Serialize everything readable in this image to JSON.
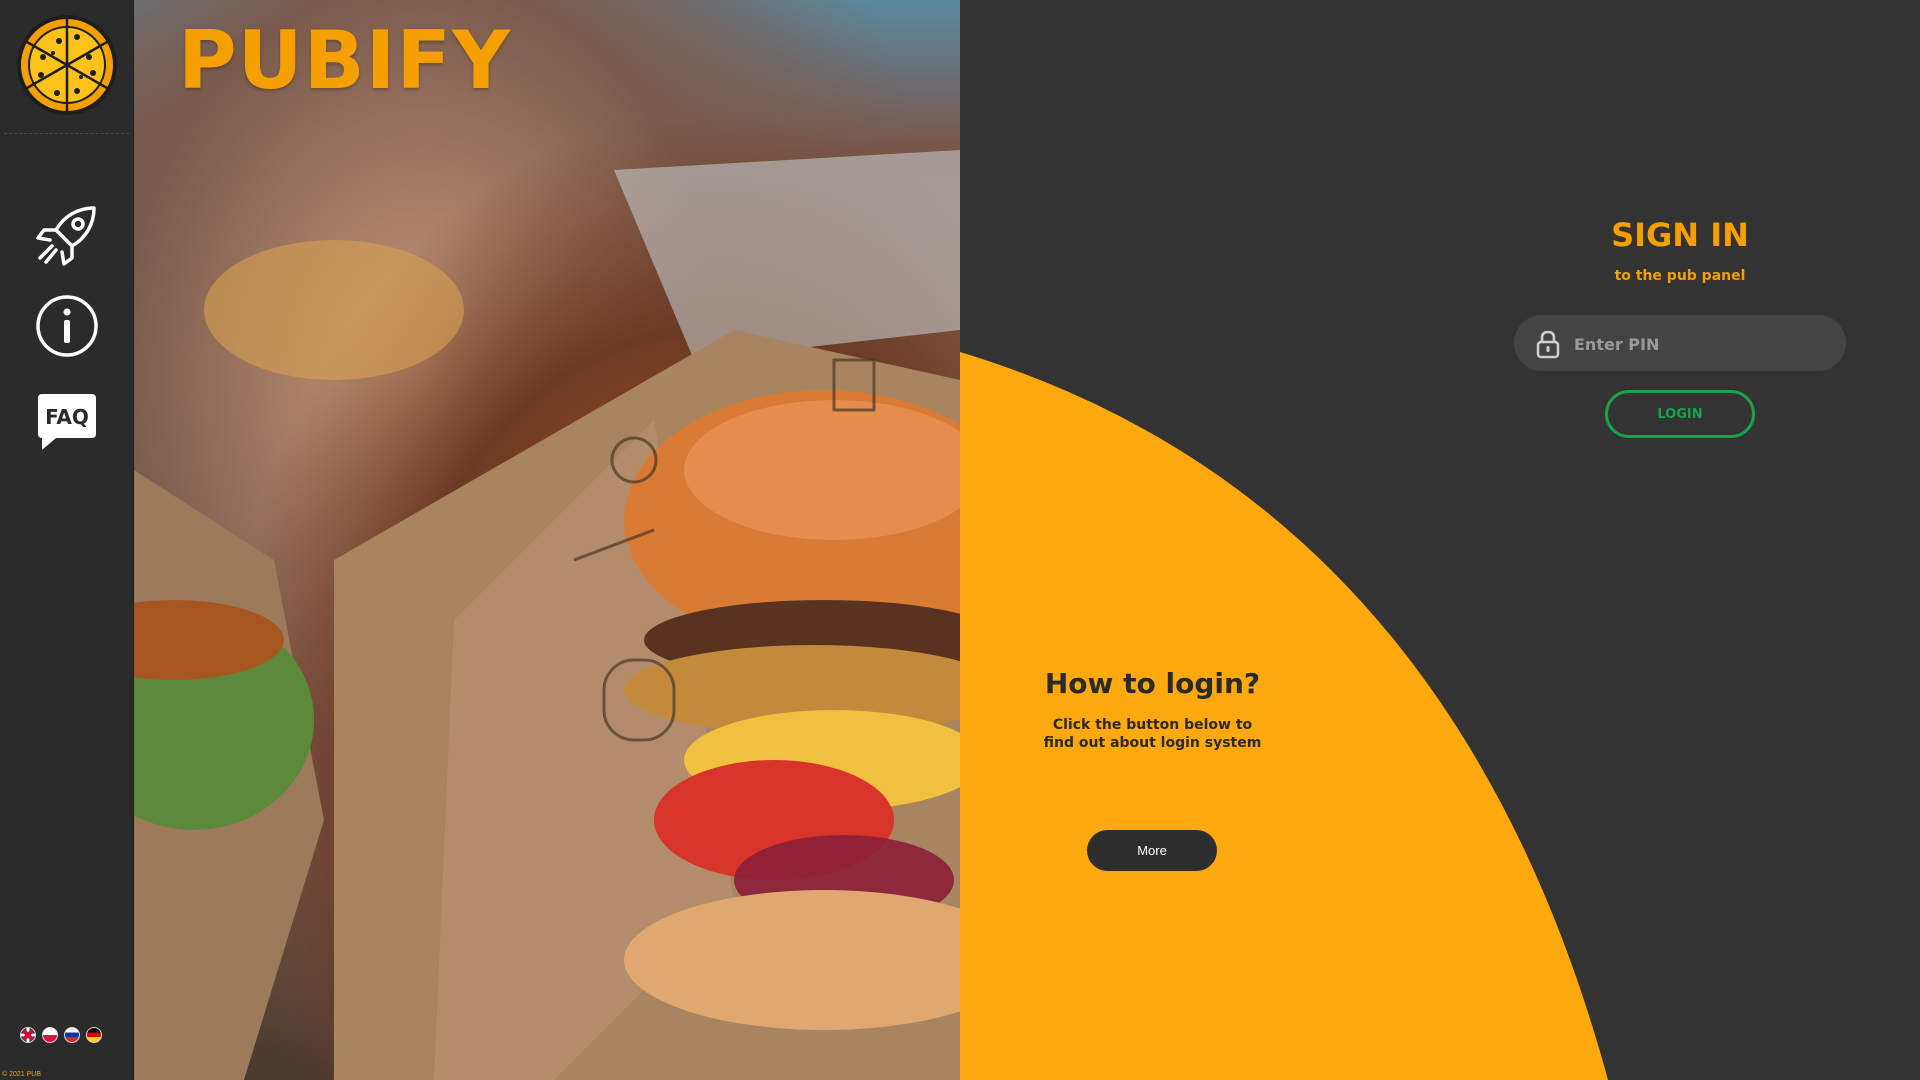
{
  "brand": {
    "name": "PUBIFY"
  },
  "sidebar": {
    "logo_icon": "pizza-icon",
    "nav": [
      {
        "icon": "rocket-icon"
      },
      {
        "icon": "info-icon"
      },
      {
        "icon": "faq-icon",
        "label": "FAQ"
      }
    ],
    "languages": [
      "en",
      "pl",
      "ru",
      "de"
    ],
    "copyright": "© 2021 PUB"
  },
  "signin": {
    "title": "SIGN IN",
    "subtitle": "to the pub panel",
    "pin_placeholder": "Enter PIN",
    "login_label": "LOGIN"
  },
  "help": {
    "title": "How to login?",
    "text": "Click the button below to find out about login system",
    "more_label": "More"
  },
  "colors": {
    "accent": "#f5a000",
    "background": "#333333",
    "sidebar": "#2b2b2b",
    "login": "#16a34a"
  }
}
